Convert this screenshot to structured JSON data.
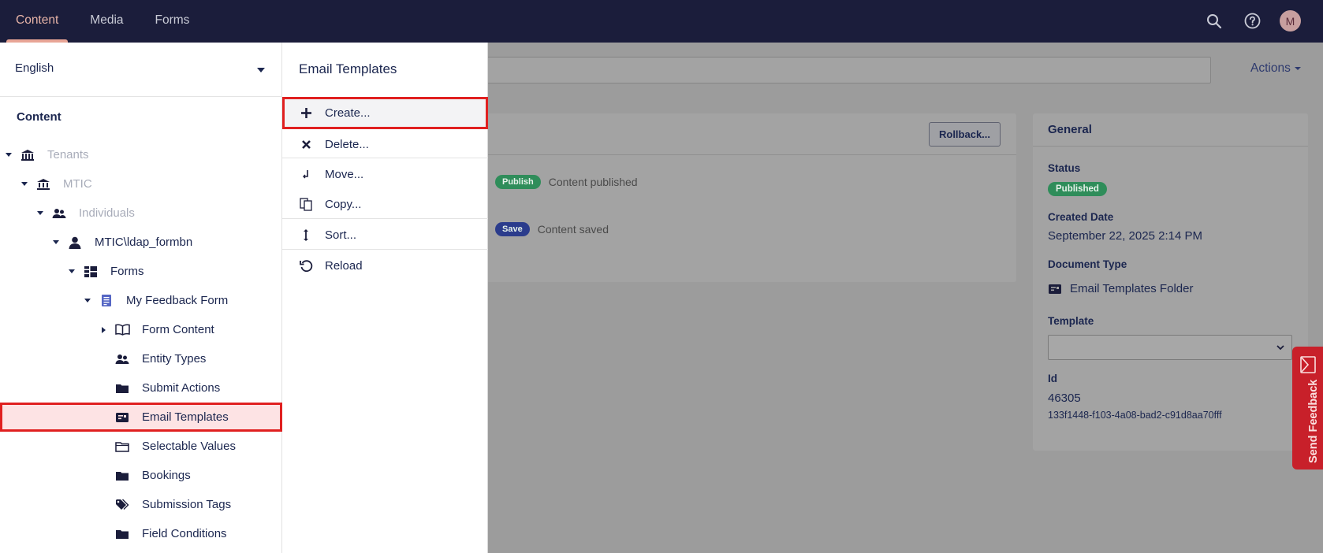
{
  "topnav": {
    "items": [
      "Content",
      "Media",
      "Forms"
    ],
    "avatar_initial": "M"
  },
  "editor": {
    "actions_label": "Actions",
    "rollback_label": "Rollback...",
    "history": [
      {
        "badge": "Publish",
        "text": "Content published",
        "color": "#2f8d5a"
      },
      {
        "badge": "Save",
        "text": "Content saved",
        "color": "#2b3c8c"
      }
    ]
  },
  "general": {
    "title": "General",
    "status_label": "Status",
    "status_value": "Published",
    "created_label": "Created Date",
    "created_value": "September 22, 2025 2:14 PM",
    "doctype_label": "Document Type",
    "doctype_value": "Email Templates Folder",
    "template_label": "Template",
    "template_value": "",
    "id_label": "Id",
    "id_value": "46305",
    "guid_value": "133f1448-f103-4a08-bad2-c91d8aa70fff"
  },
  "send_feedback": "Send Feedback",
  "tree": {
    "language": "English",
    "title": "Content",
    "nodes": [
      {
        "label": "Tenants",
        "icon": "tenants-icon"
      },
      {
        "label": "MTIC",
        "icon": "institution-icon"
      },
      {
        "label": "Individuals",
        "icon": "users-icon"
      },
      {
        "label": "MTIC\\ldap_formbn",
        "icon": "user-icon"
      },
      {
        "label": "Forms",
        "icon": "forms-grid-icon"
      },
      {
        "label": "My Feedback Form",
        "icon": "document-icon"
      },
      {
        "label": "Form Content",
        "icon": "book-icon"
      },
      {
        "label": "Entity Types",
        "icon": "users-icon"
      },
      {
        "label": "Submit Actions",
        "icon": "folder-icon"
      },
      {
        "label": "Email Templates",
        "icon": "email-card-icon"
      },
      {
        "label": "Selectable Values",
        "icon": "folder-outline-icon"
      },
      {
        "label": "Bookings",
        "icon": "folder-icon"
      },
      {
        "label": "Submission Tags",
        "icon": "tag-icon"
      },
      {
        "label": "Field Conditions",
        "icon": "folder-icon"
      }
    ]
  },
  "menu": {
    "title": "Email Templates",
    "items": [
      "Create...",
      "Delete...",
      "Move...",
      "Copy...",
      "Sort...",
      "Reload"
    ]
  },
  "colors": {
    "topbar": "#1b1d3b",
    "highlight": "#e02020",
    "publish": "#2f8d5a",
    "save": "#2b3c8c",
    "feedback": "#c8202a"
  }
}
